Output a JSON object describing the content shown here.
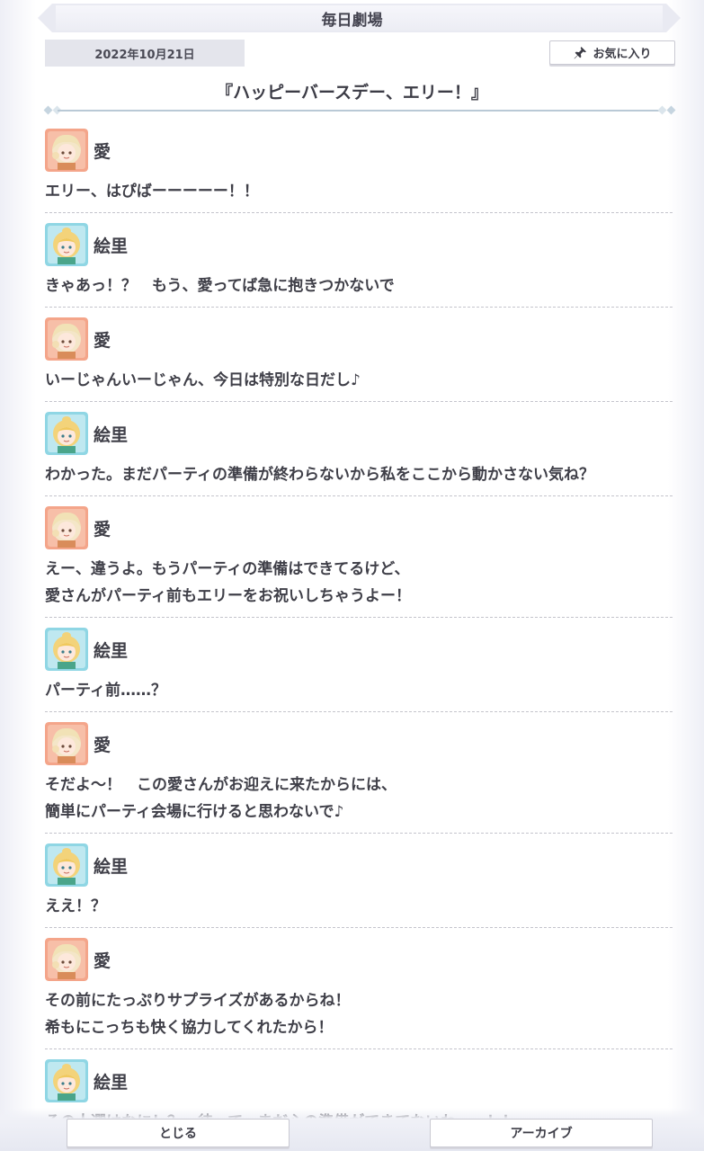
{
  "header": {
    "title": "毎日劇場",
    "date": "2022年10月21日",
    "favorite_label": "お気に入り"
  },
  "story": {
    "title": "『ハッピーバースデー、エリー！』"
  },
  "dialogue": [
    {
      "speaker": "愛",
      "avatar": "ai-avatar",
      "lines": [
        "エリー、はぴばーーーーー！！"
      ]
    },
    {
      "speaker": "絵里",
      "avatar": "eli-avatar",
      "lines": [
        "きゃあっ！？　もう、愛ってば急に抱きつかないで"
      ]
    },
    {
      "speaker": "愛",
      "avatar": "ai-avatar",
      "lines": [
        "いーじゃんいーじゃん、今日は特別な日だし♪"
      ]
    },
    {
      "speaker": "絵里",
      "avatar": "eli-avatar",
      "lines": [
        "わかった。まだパーティの準備が終わらないから私をここから動かさない気ね？"
      ]
    },
    {
      "speaker": "愛",
      "avatar": "ai-avatar",
      "lines": [
        "えー、違うよ。もうパーティの準備はできてるけど、",
        "愛さんがパーティ前もエリーをお祝いしちゃうよー！"
      ]
    },
    {
      "speaker": "絵里",
      "avatar": "eli-avatar",
      "lines": [
        "パーティ前……？"
      ]
    },
    {
      "speaker": "愛",
      "avatar": "ai-avatar",
      "lines": [
        "そだよ〜！　この愛さんがお迎えに来たからには、",
        "簡単にパーティ会場に行けると思わないで♪"
      ]
    },
    {
      "speaker": "絵里",
      "avatar": "eli-avatar",
      "lines": [
        "ええ！？"
      ]
    },
    {
      "speaker": "愛",
      "avatar": "ai-avatar",
      "lines": [
        "その前にたっぷりサプライズがあるからね！",
        "希もにこっちも快く協力してくれたから！"
      ]
    },
    {
      "speaker": "絵里",
      "avatar": "eli-avatar",
      "lines": [
        "その人選はなに！？　待って、まだ心の準備ができてないわーー！！"
      ]
    }
  ],
  "footer": {
    "close_label": "とじる",
    "archive_label": "アーカイブ"
  },
  "colors": {
    "ai_avatar_bg": "#f4a58a",
    "eli_avatar_bg": "#8fd6e4",
    "text": "#3f3f48",
    "divider": "#c4c4cc"
  },
  "icons": {
    "favorite": "pin-icon"
  }
}
